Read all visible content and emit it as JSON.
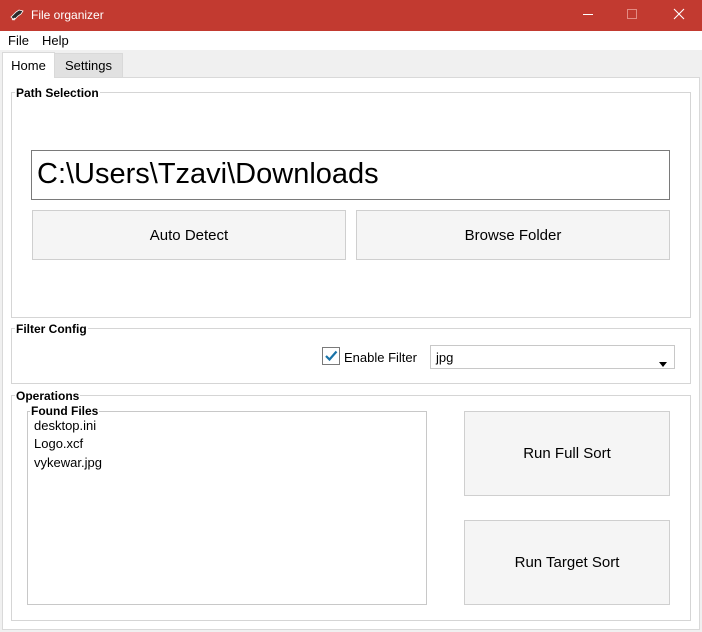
{
  "window": {
    "title": "File organizer",
    "accent_color": "#c23a30",
    "icon": "app-logo-icon"
  },
  "menu": [
    "File",
    "Help"
  ],
  "tabs": {
    "home": "Home",
    "settings": "Settings",
    "active": "Home"
  },
  "path_selection": {
    "title": "Path Selection",
    "path_value": "C:\\Users\\Tzavi\\Downloads",
    "auto_detect_label": "Auto Detect",
    "browse_label": "Browse Folder"
  },
  "filter_config": {
    "title": "Filter Config",
    "enable_label": "Enable Filter",
    "enabled": true,
    "selected_type": "jpg"
  },
  "operations": {
    "title": "Operations",
    "found_files_title": "Found Files",
    "files": [
      "desktop.ini",
      "Logo.xcf",
      "vykewar.jpg"
    ],
    "run_full_label": "Run Full Sort",
    "run_target_label": "Run Target Sort"
  }
}
